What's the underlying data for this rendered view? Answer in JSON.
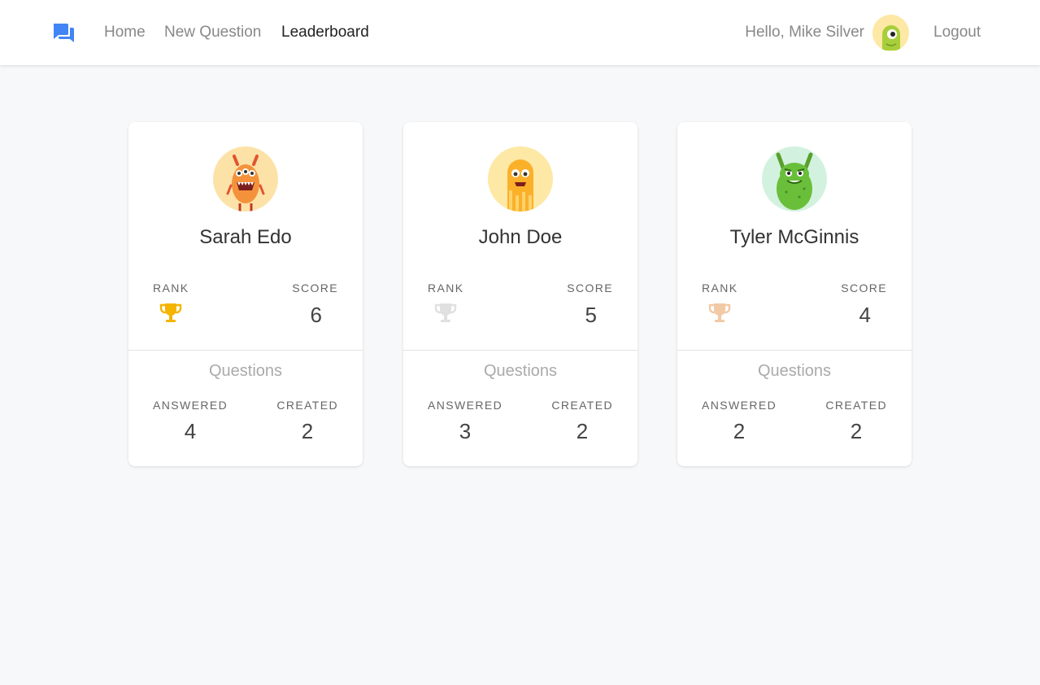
{
  "nav": {
    "home": "Home",
    "new_question": "New Question",
    "leaderboard": "Leaderboard",
    "greeting": "Hello, Mike Silver",
    "logout": "Logout",
    "logo_icon": "forum-icon"
  },
  "colors": {
    "brand": "#4285f4",
    "gold": "#f5b400",
    "silver": "#e0e0e0",
    "bronze": "#f1c9a5"
  },
  "cards": [
    {
      "name": "Sarah Edo",
      "rank_label": "RANK",
      "score_label": "SCORE",
      "score": "6",
      "trophy": "gold-trophy-icon",
      "questions_title": "Questions",
      "answered_label": "ANSWERED",
      "created_label": "CREATED",
      "answered": "4",
      "created": "2"
    },
    {
      "name": "John Doe",
      "rank_label": "RANK",
      "score_label": "SCORE",
      "score": "5",
      "trophy": "silver-trophy-icon",
      "questions_title": "Questions",
      "answered_label": "ANSWERED",
      "created_label": "CREATED",
      "answered": "3",
      "created": "2"
    },
    {
      "name": "Tyler McGinnis",
      "rank_label": "RANK",
      "score_label": "SCORE",
      "score": "4",
      "trophy": "bronze-trophy-icon",
      "questions_title": "Questions",
      "answered_label": "ANSWERED",
      "created_label": "CREATED",
      "answered": "2",
      "created": "2"
    }
  ]
}
